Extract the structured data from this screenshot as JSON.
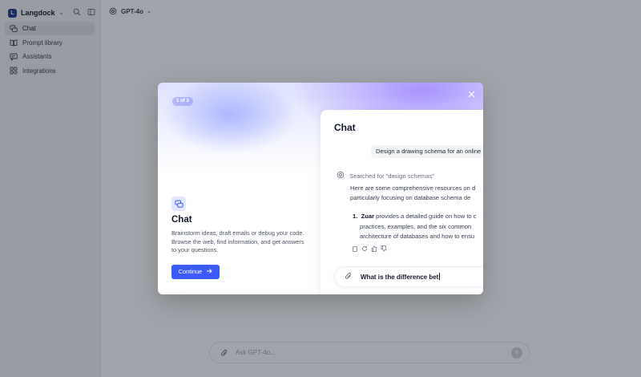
{
  "app": {
    "brand": "Langdock"
  },
  "sidebar": {
    "items": [
      {
        "label": "Chat",
        "icon": "chat-icon",
        "active": true
      },
      {
        "label": "Prompt library",
        "icon": "book-icon",
        "active": false
      },
      {
        "label": "Assistants",
        "icon": "assistant-icon",
        "active": false
      },
      {
        "label": "Integrations",
        "icon": "integrations-icon",
        "active": false
      }
    ]
  },
  "header": {
    "model": "GPT-4o"
  },
  "chat_input": {
    "placeholder": "Ask GPT-4o..."
  },
  "modal": {
    "step": "1 of 3",
    "feature_title": "Chat",
    "feature_description": "Brainstorm ideas, draft emails or debug your code. Browse the web, find information, and get answers to your questions.",
    "continue_label": "Continue",
    "preview": {
      "title": "Chat",
      "user_message": "Design a drawing schema for an online",
      "search_status": "Searched for \"design schemas\"",
      "answer_line1": "Here are some comprehensive resources on d",
      "answer_line2": "particularly focusing on database schema de",
      "list_number": "1.",
      "list_strong": "Zuar",
      "list_line1": "provides a detailed guide on how to c",
      "list_line2": "practices, examples, and the six common",
      "list_line3": "architecture of databases and how to ensu",
      "input_text": "What is the difference bet"
    }
  },
  "colors": {
    "accent": "#3b5bfd",
    "brand": "#1e3a8a"
  }
}
